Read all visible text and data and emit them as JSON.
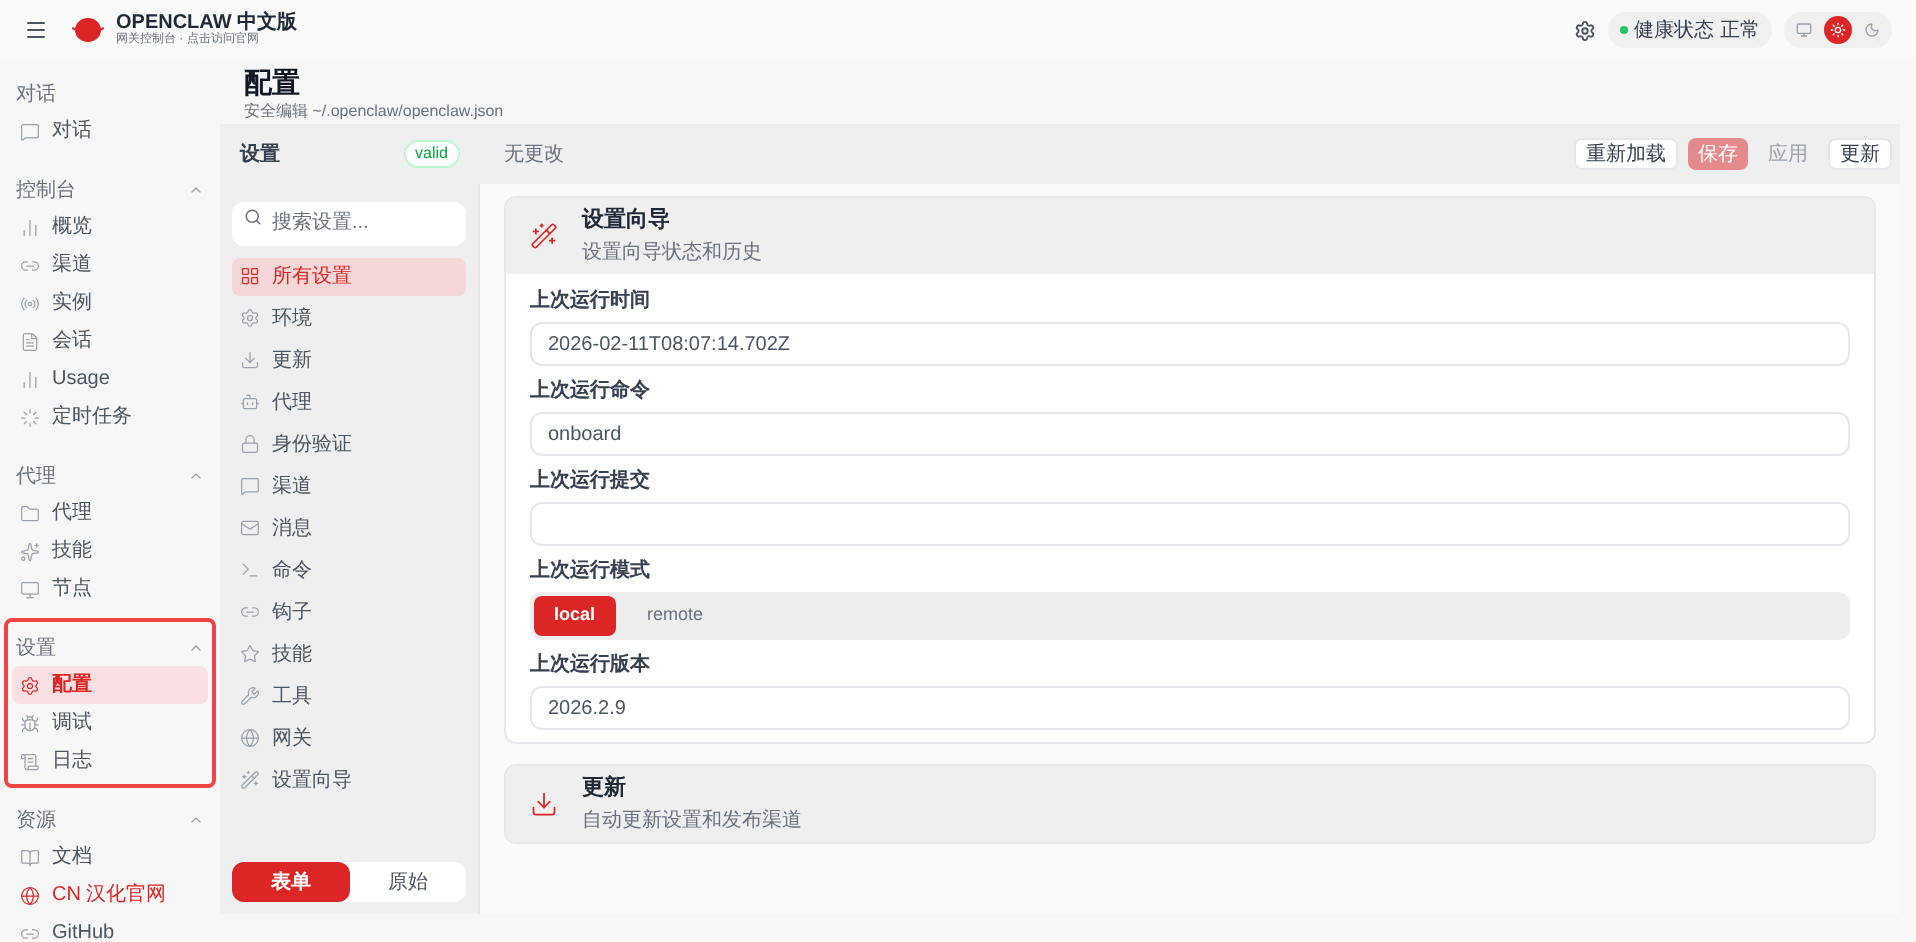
{
  "brand": {
    "name": "OPENCLAW 中文版",
    "subtitle": "网关控制台 · 点击访问官网"
  },
  "health": {
    "label": "健康状态",
    "value": "正常",
    "color": "#22c55e"
  },
  "theme_options": [
    {
      "kind": "monitor",
      "selected": false
    },
    {
      "kind": "sun",
      "selected": true
    },
    {
      "kind": "moon",
      "selected": false
    }
  ],
  "sidebar": {
    "groups": [
      {
        "label": "对话",
        "highlighted": false,
        "items": [
          {
            "label": "对话",
            "selected": false
          }
        ]
      },
      {
        "label": "控制台",
        "highlighted": false,
        "items": [
          {
            "label": "概览",
            "selected": false
          },
          {
            "label": "渠道",
            "selected": false
          },
          {
            "label": "实例",
            "selected": false
          },
          {
            "label": "会话",
            "selected": false
          },
          {
            "label": "Usage",
            "selected": false
          },
          {
            "label": "定时任务",
            "selected": false
          }
        ]
      },
      {
        "label": "代理",
        "highlighted": false,
        "items": [
          {
            "label": "代理",
            "selected": false
          },
          {
            "label": "技能",
            "selected": false
          },
          {
            "label": "节点",
            "selected": false
          }
        ]
      },
      {
        "label": "设置",
        "highlighted": true,
        "items": [
          {
            "label": "配置",
            "selected": true
          },
          {
            "label": "调试",
            "selected": false
          },
          {
            "label": "日志",
            "selected": false
          }
        ]
      },
      {
        "label": "资源",
        "highlighted": false,
        "items": [
          {
            "label": "文档",
            "selected": false
          },
          {
            "label": "CN 汉化官网",
            "selected": false,
            "accent": true
          },
          {
            "label": "GitHub",
            "selected": false
          }
        ]
      }
    ]
  },
  "page": {
    "title": "配置",
    "subtitle": "安全编辑 ~/.openclaw/openclaw.json"
  },
  "settings": {
    "title": "设置",
    "badge": "valid",
    "status": "无更改",
    "actions": [
      {
        "label": "重新加载",
        "kind": "normal"
      },
      {
        "label": "保存",
        "kind": "primary-disabled"
      },
      {
        "label": "应用",
        "kind": "disabled"
      },
      {
        "label": "更新",
        "kind": "normal"
      }
    ],
    "search": {
      "placeholder": "搜索设置..."
    },
    "nav": [
      {
        "label": "所有设置",
        "selected": true
      },
      {
        "label": "环境",
        "selected": false
      },
      {
        "label": "更新",
        "selected": false
      },
      {
        "label": "代理",
        "selected": false
      },
      {
        "label": "身份验证",
        "selected": false
      },
      {
        "label": "渠道",
        "selected": false
      },
      {
        "label": "消息",
        "selected": false
      },
      {
        "label": "命令",
        "selected": false
      },
      {
        "label": "钩子",
        "selected": false
      },
      {
        "label": "技能",
        "selected": false
      },
      {
        "label": "工具",
        "selected": false
      },
      {
        "label": "网关",
        "selected": false
      },
      {
        "label": "设置向导",
        "selected": false
      }
    ],
    "modes": [
      {
        "label": "表单",
        "selected": true
      },
      {
        "label": "原始",
        "selected": false
      }
    ],
    "sections": [
      {
        "title": "设置向导",
        "description": "设置向导状态和历史",
        "fields": [
          {
            "kind": "text",
            "label": "上次运行时间",
            "value": "2026-02-11T08:07:14.702Z"
          },
          {
            "kind": "text",
            "label": "上次运行命令",
            "value": "onboard"
          },
          {
            "kind": "text",
            "label": "上次运行提交"
          },
          {
            "kind": "segmented",
            "label": "上次运行模式",
            "options": [
              {
                "label": "local",
                "selected": true
              },
              {
                "label": "remote",
                "selected": false
              }
            ]
          },
          {
            "kind": "text",
            "label": "上次运行版本",
            "value": "2026.2.9"
          }
        ]
      },
      {
        "title": "更新",
        "description": "自动更新设置和发布渠道"
      }
    ]
  }
}
